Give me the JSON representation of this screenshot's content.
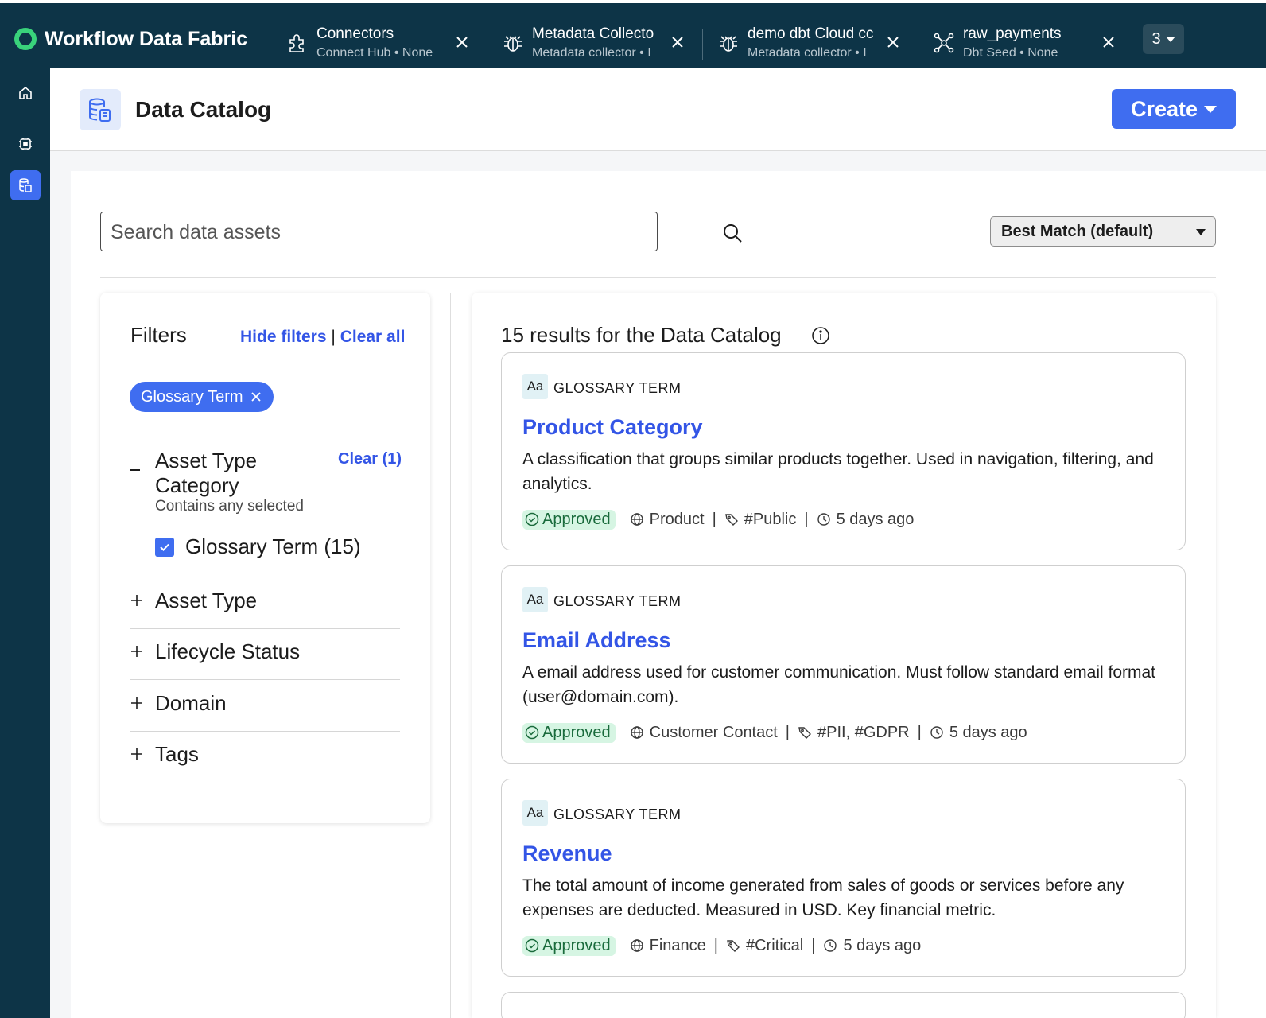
{
  "brand": {
    "name": "Workflow Data Fabric",
    "logo_color": "#39d27b"
  },
  "colors": {
    "nav_bg": "#0d3447",
    "accent": "#3f6df0",
    "link": "#3355e6",
    "approved_bg": "#d6f5e3",
    "approved_text": "#1a6b3c"
  },
  "window_tabs": [
    {
      "title": "Connectors",
      "subtitle": "Connect Hub • None",
      "icon": "puzzle-icon"
    },
    {
      "title": "Metadata Collecto",
      "subtitle": "Metadata collector • I",
      "icon": "bug-icon"
    },
    {
      "title": "demo dbt Cloud cc",
      "subtitle": "Metadata collector • I",
      "icon": "bug-icon"
    },
    {
      "title": "raw_payments",
      "subtitle": "Dbt Seed • None",
      "icon": "network-icon"
    }
  ],
  "overflow_count": "3",
  "rail": {
    "items": [
      "home-icon",
      "chip-icon",
      "catalog-icon"
    ],
    "active": "catalog-icon"
  },
  "page": {
    "title": "Data Catalog",
    "create_label": "Create"
  },
  "search": {
    "placeholder": "Search data assets",
    "value": ""
  },
  "sort": {
    "selected": "Best Match (default)"
  },
  "filters": {
    "title": "Filters",
    "hide_label": "Hide filters",
    "separator": "|",
    "clear_all_label": "Clear all",
    "active_chip": "Glossary Term",
    "expanded_section": {
      "title": "Asset Type Category",
      "clear_label": "Clear (1)",
      "mode": "Contains any selected",
      "options": [
        {
          "label": "Glossary Term (15)",
          "checked": true
        }
      ]
    },
    "collapsed_sections": [
      "Asset Type",
      "Lifecycle Status",
      "Domain",
      "Tags"
    ]
  },
  "results": {
    "heading": "15 results for the Data Catalog",
    "cards": [
      {
        "type_abbr": "Aa",
        "type": "GLOSSARY TERM",
        "title": "Product Category",
        "description": "A classification that groups similar products together. Used in navigation, filtering, and analytics.",
        "status": "Approved",
        "domain": "Product",
        "tags": "#Public",
        "updated": "5 days ago"
      },
      {
        "type_abbr": "Aa",
        "type": "GLOSSARY TERM",
        "title": "Email Address",
        "description": "A email address used for customer communication. Must follow standard email format (user@domain.com).",
        "status": "Approved",
        "domain": "Customer Contact",
        "tags": "#PII, #GDPR",
        "updated": "5 days ago"
      },
      {
        "type_abbr": "Aa",
        "type": "GLOSSARY TERM",
        "title": "Revenue",
        "description": "The total amount of income generated from sales of goods or services before any expenses are deducted. Measured in USD. Key financial metric.",
        "status": "Approved",
        "domain": "Finance",
        "tags": "#Critical",
        "updated": "5 days ago"
      }
    ]
  }
}
